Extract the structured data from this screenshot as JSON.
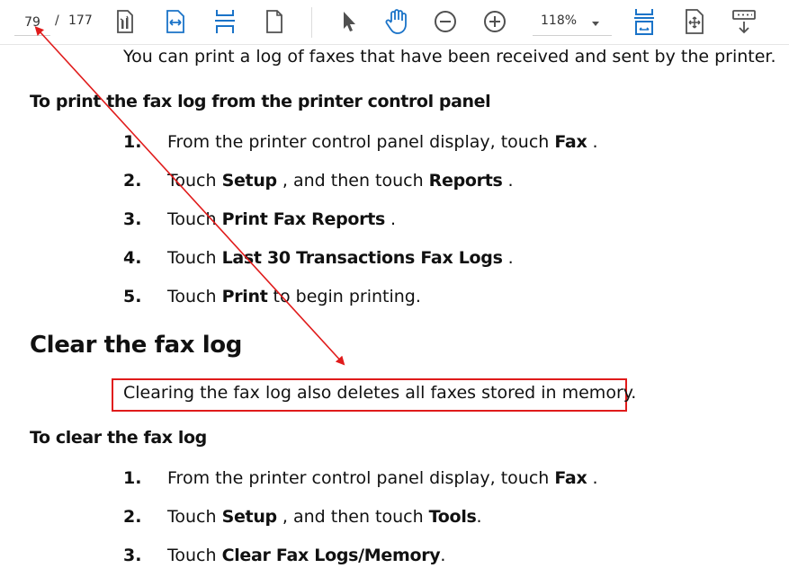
{
  "toolbar": {
    "page_current": "79",
    "page_separator": "/",
    "page_total": "177",
    "zoom": "118%",
    "icons": [
      "page-thumbnails-icon",
      "fit-width-icon",
      "fit-page-icon",
      "single-page-icon",
      "select-pointer-icon",
      "hand-pan-icon",
      "zoom-out-icon",
      "zoom-in-icon",
      "zoom-dropdown-icon",
      "scroll-mode-icon",
      "rotate-view-icon",
      "more-tools-icon"
    ]
  },
  "document": {
    "intro": "You can print a log of faxes that have been received and sent by the printer.",
    "section1": {
      "title": "To print the fax log from the printer control panel",
      "steps": [
        {
          "num": "1.",
          "pre": "From the printer control panel display, touch ",
          "bold": "Fax",
          "post": " ."
        },
        {
          "num": "2.",
          "pre": "Touch ",
          "bold": "Setup",
          "mid": " , and then touch ",
          "bold2": "Reports",
          "post": " ."
        },
        {
          "num": "3.",
          "pre": "Touch ",
          "bold": "Print Fax Reports",
          "post": " ."
        },
        {
          "num": "4.",
          "pre": "Touch ",
          "bold": "Last 30 Transactions Fax Logs",
          "post": " ."
        },
        {
          "num": "5.",
          "pre": "Touch ",
          "bold": "Print",
          "post": " to begin printing."
        }
      ]
    },
    "clear_heading": "Clear the fax log",
    "clear_note": "Clearing the fax log also deletes all faxes stored in memory.",
    "section2": {
      "title": "To clear the fax log",
      "steps": [
        {
          "num": "1.",
          "pre": "From the printer control panel display, touch ",
          "bold": "Fax",
          "post": " ."
        },
        {
          "num": "2.",
          "pre": "Touch ",
          "bold": "Setup",
          "mid": " , and then touch ",
          "bold2": "Tools",
          "post": "."
        },
        {
          "num": "3.",
          "pre": "Touch ",
          "bold": "Clear Fax Logs/Memory",
          "post": "."
        }
      ]
    }
  },
  "colors": {
    "toolbar_icon": "#1a73c8",
    "toolbar_icon_gray": "#505050",
    "annotation_red": "#e01b1b"
  }
}
